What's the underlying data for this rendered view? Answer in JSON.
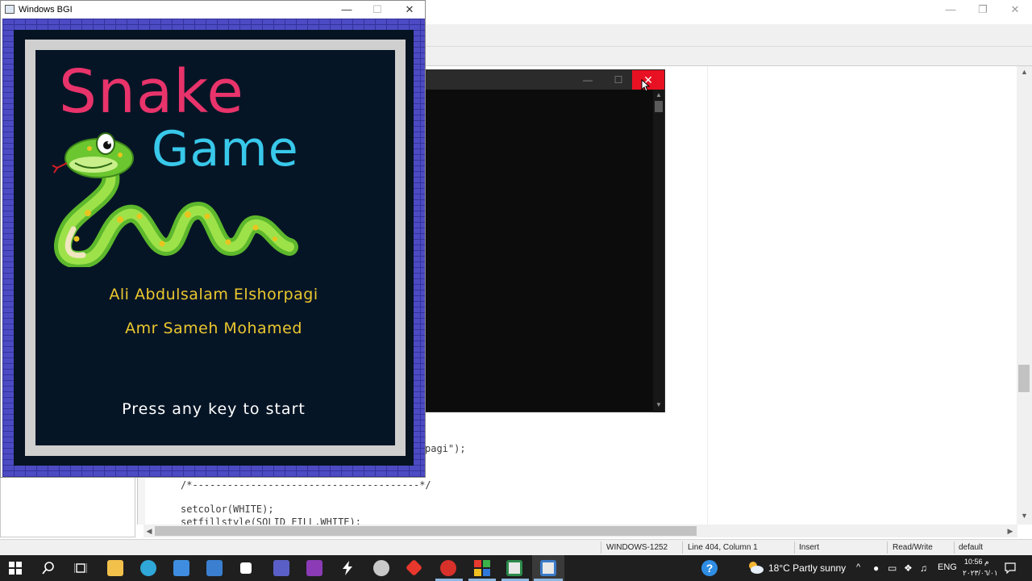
{
  "ide": {
    "code_lines": [
      "pagi\");",
      "/*---------------------------------------*/",
      "setcolor(WHITE);",
      "setfillstyle(SOLID_FILL,WHITE);"
    ],
    "status": {
      "encoding": "WINDOWS-1252",
      "position": "Line 404, Column 1",
      "mode": "Insert",
      "access": "Read/Write",
      "profile": "default"
    }
  },
  "bgi_window": {
    "title": "Windows BGI",
    "heading_1": "Snake",
    "heading_2": "Game",
    "author_1": "Ali Abdulsalam Elshorpagi",
    "author_2": "Amr Sameh Mohamed",
    "prompt": "Press any key to start",
    "colors": {
      "snake_title": "#e8336b",
      "game_title": "#38c8ea",
      "authors": "#ecc82e",
      "brick": "#4d4bc4",
      "panel": "#061526"
    }
  },
  "console_window": {
    "close_icon": "close-icon",
    "close_color": "#e81123"
  },
  "taskbar": {
    "icons": [
      "windows-start-icon",
      "search-icon",
      "task-view-icon",
      "file-explorer-icon",
      "edge-icon",
      "store-icon",
      "mail-icon",
      "dropbox-icon",
      "teams-icon",
      "app-g-icon",
      "app-bolt-icon",
      "app-figure-icon",
      "app-diamond-icon",
      "app-red-circle-icon",
      "app-grid-icon",
      "devcpp-icon",
      "bgi-window-icon",
      "help-icon"
    ],
    "weather": "18°C  Partly sunny",
    "language": "ENG",
    "time": "10:56 م",
    "date": "٢٠٢٣/٠٦/٠١"
  }
}
